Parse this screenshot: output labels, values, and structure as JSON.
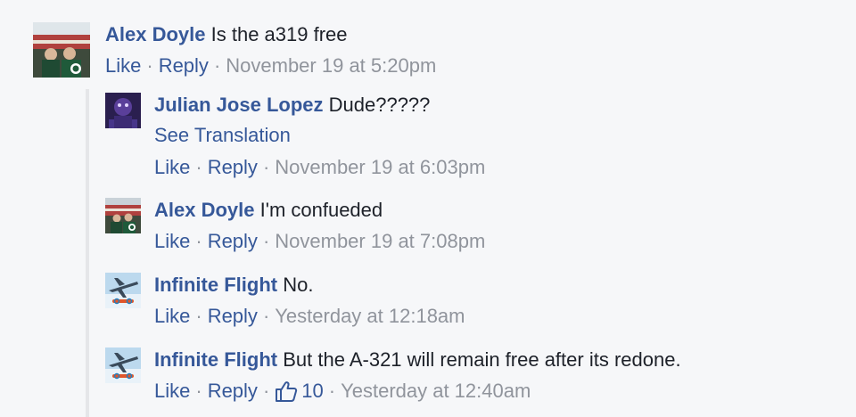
{
  "comments": [
    {
      "author": "Alex Doyle",
      "text": "Is the a319 free",
      "like_label": "Like",
      "reply_label": "Reply",
      "timestamp": "November 19 at 5:20pm",
      "avatar": "alex-doyle-avatar"
    }
  ],
  "replies": [
    {
      "author": "Julian Jose Lopez",
      "text": "Dude?????",
      "see_translation": "See Translation",
      "like_label": "Like",
      "reply_label": "Reply",
      "timestamp": "November 19 at 6:03pm",
      "avatar": "julian-jose-lopez-avatar"
    },
    {
      "author": "Alex Doyle",
      "text": "I'm confueded",
      "like_label": "Like",
      "reply_label": "Reply",
      "timestamp": "November 19 at 7:08pm",
      "avatar": "alex-doyle-avatar"
    },
    {
      "author": "Infinite Flight",
      "text": "No.",
      "like_label": "Like",
      "reply_label": "Reply",
      "timestamp": "Yesterday at 12:18am",
      "avatar": "infinite-flight-avatar"
    },
    {
      "author": "Infinite Flight",
      "text": "But the A-321 will remain free after its redone.",
      "like_label": "Like",
      "reply_label": "Reply",
      "like_count": "10",
      "timestamp": "Yesterday at 12:40am",
      "avatar": "infinite-flight-avatar"
    }
  ],
  "separator": "·",
  "colors": {
    "link": "#365899",
    "text": "#1d2129",
    "meta": "#90949c",
    "background": "#f6f7f9"
  }
}
